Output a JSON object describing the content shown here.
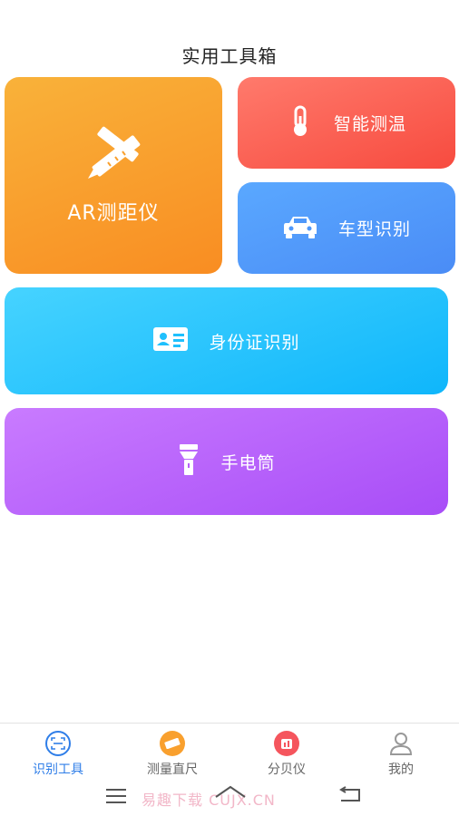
{
  "page": {
    "title": "实用工具箱"
  },
  "cards": {
    "ar": {
      "label": "AR测距仪",
      "icon": "ruler-pencil-icon"
    },
    "temperature": {
      "label": "智能测温",
      "icon": "thermometer-icon"
    },
    "car": {
      "label": "车型识别",
      "icon": "car-icon"
    },
    "id_card": {
      "label": "身份证识别",
      "icon": "id-card-icon"
    },
    "flashlight": {
      "label": "手电筒",
      "icon": "flashlight-icon"
    }
  },
  "tabs": [
    {
      "label": "识别工具",
      "icon": "scan-icon",
      "active": true
    },
    {
      "label": "测量直尺",
      "icon": "ruler-icon",
      "active": false
    },
    {
      "label": "分贝仪",
      "icon": "decibel-icon",
      "active": false
    },
    {
      "label": "我的",
      "icon": "person-icon",
      "active": false
    }
  ],
  "system_bar": {
    "watermark": "易趣下载 CUJX.CN"
  },
  "colors": {
    "ar": "#f9a02e",
    "temperature": "#f75a4c",
    "car": "#4f98fa",
    "id_card": "#1fc0fd",
    "flashlight": "#b65ff9",
    "active_tab": "#2f7ee8"
  }
}
